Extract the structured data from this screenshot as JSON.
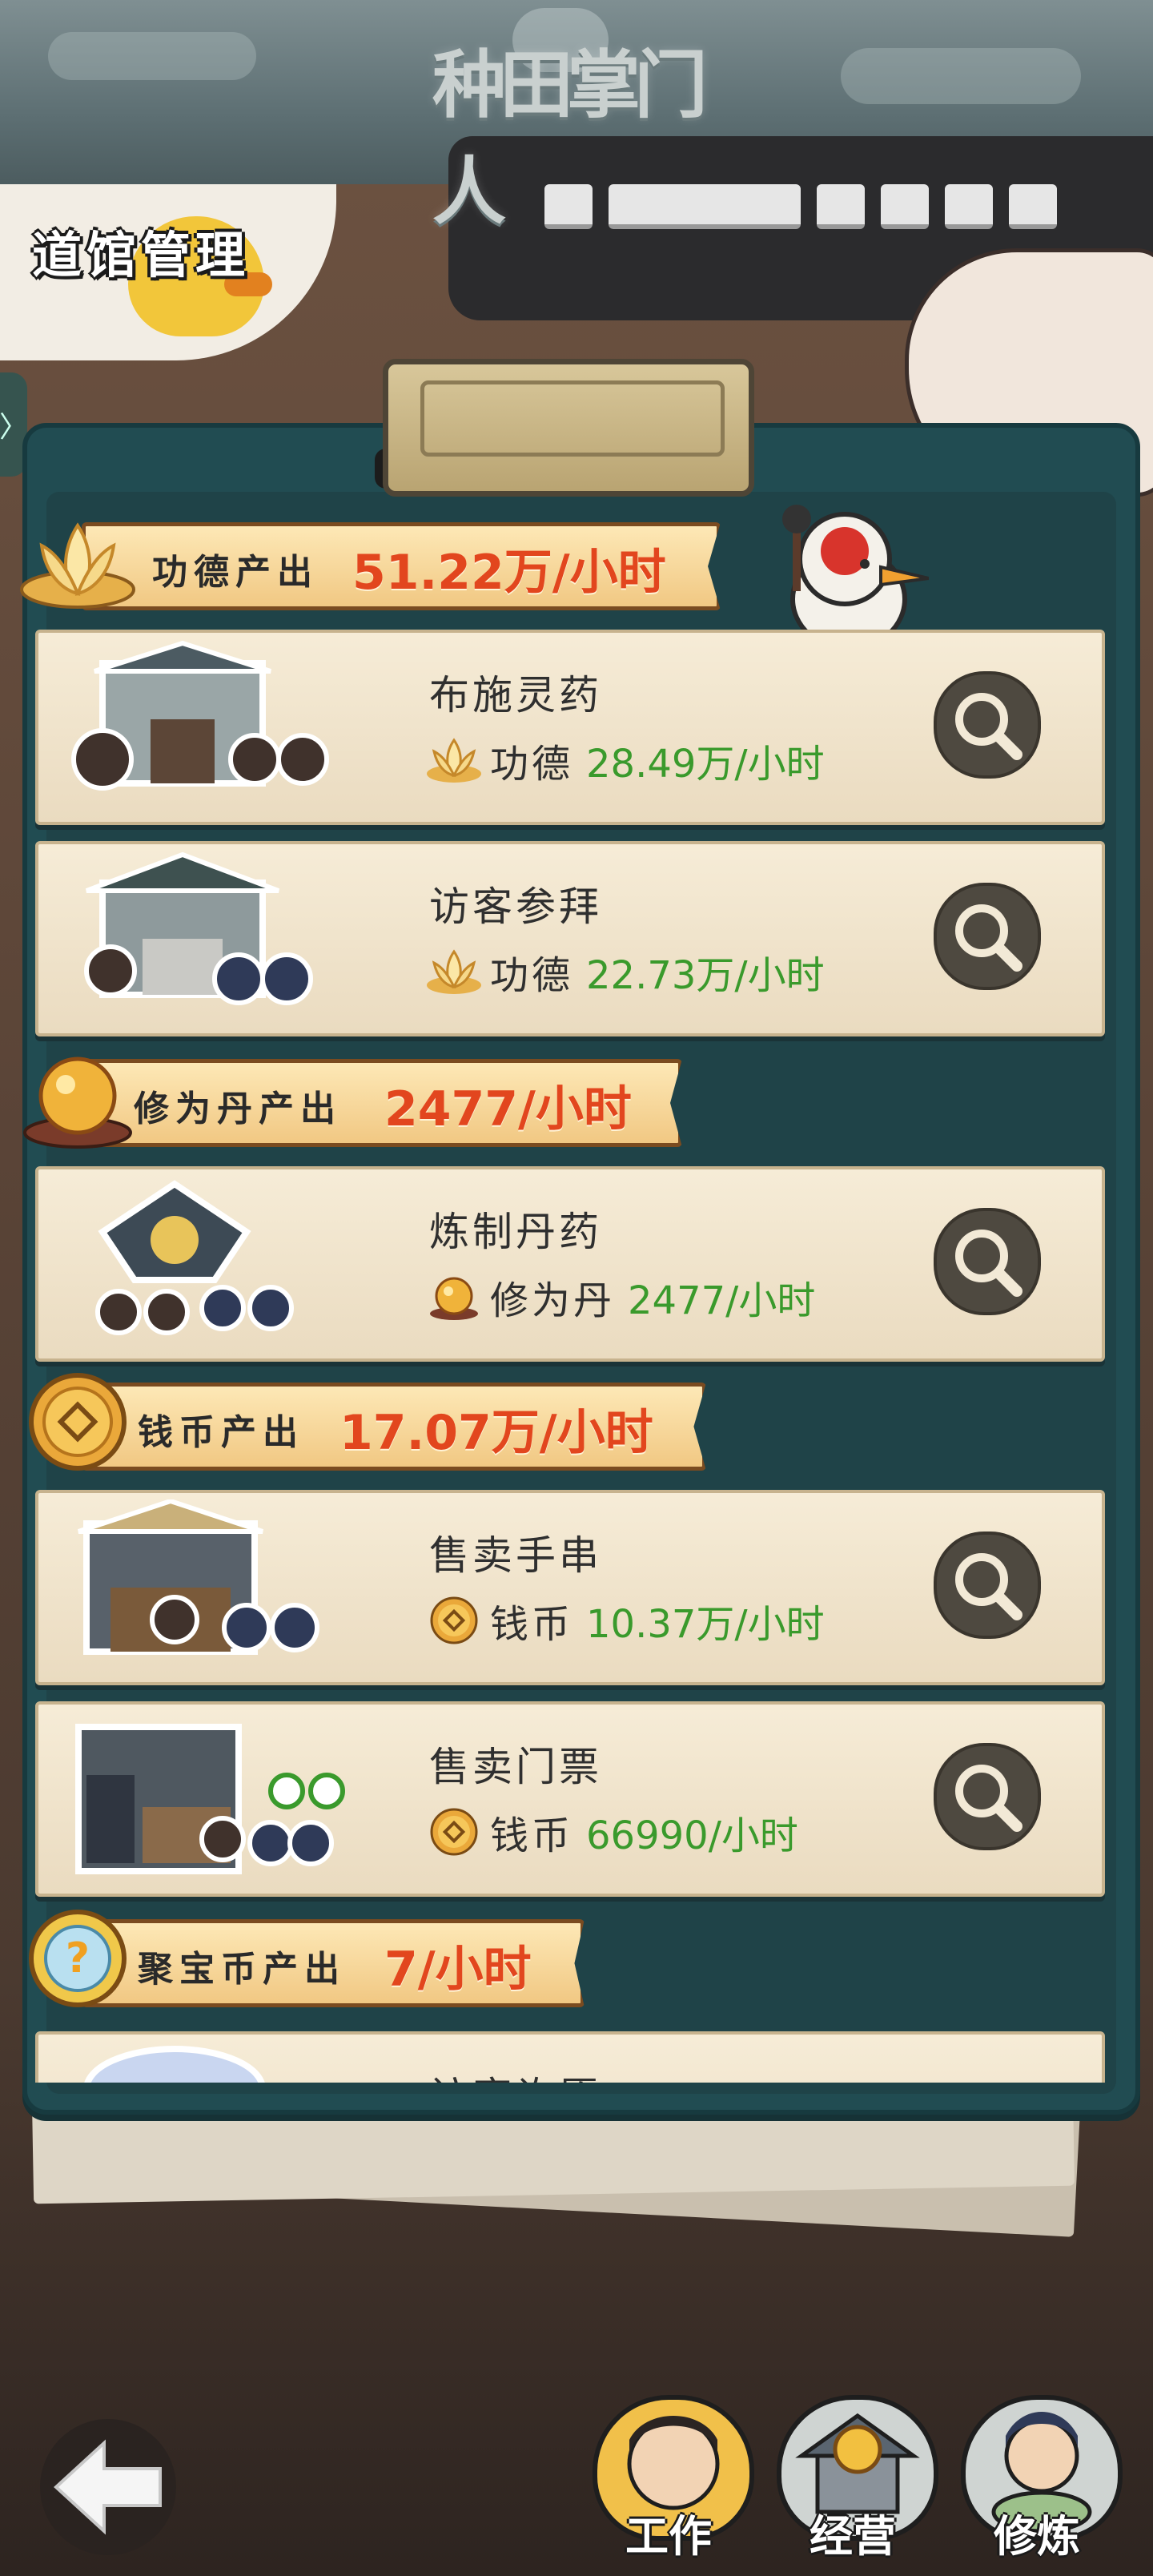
{
  "game_logo": "种田掌门人",
  "page_title": "道馆管理",
  "side_tab_glyph": "〉",
  "sections": [
    {
      "icon": "lotus-icon",
      "label": "功德产出",
      "value": "51.22万/小时",
      "items": [
        {
          "name": "布施灵药",
          "currency_label": "功德",
          "rate": "28.49万/小时",
          "currency_icon": "lotus-icon"
        },
        {
          "name": "访客参拜",
          "currency_label": "功德",
          "rate": "22.73万/小时",
          "currency_icon": "lotus-icon"
        }
      ]
    },
    {
      "icon": "pill-orb-icon",
      "label": "修为丹产出",
      "value": "2477/小时",
      "items": [
        {
          "name": "炼制丹药",
          "currency_label": "修为丹",
          "rate": "2477/小时",
          "currency_icon": "pill-orb-icon"
        }
      ]
    },
    {
      "icon": "coin-icon",
      "label": "钱币产出",
      "value": "17.07万/小时",
      "items": [
        {
          "name": "售卖手串",
          "currency_label": "钱币",
          "rate": "10.37万/小时",
          "currency_icon": "coin-icon"
        },
        {
          "name": "售卖门票",
          "currency_label": "钱币",
          "rate": "66990/小时",
          "currency_icon": "coin-icon"
        }
      ]
    },
    {
      "icon": "treasure-coin-icon",
      "label": "聚宝币产出",
      "value": "7/小时",
      "items": [
        {
          "name": "访客许愿",
          "currency_label": "",
          "rate": "",
          "currency_icon": ""
        }
      ]
    }
  ],
  "bottom_nav": [
    {
      "label": "工作",
      "icon": "disciple-portrait-icon",
      "active": true
    },
    {
      "label": "经营",
      "icon": "temple-coin-icon",
      "active": false
    },
    {
      "label": "修炼",
      "icon": "meditating-disciple-icon",
      "active": false
    }
  ],
  "colors": {
    "board": "#214c52",
    "card": "#f3e7d0",
    "rate_green": "#3a9a2c",
    "header_value_orange": "#e2461e"
  }
}
